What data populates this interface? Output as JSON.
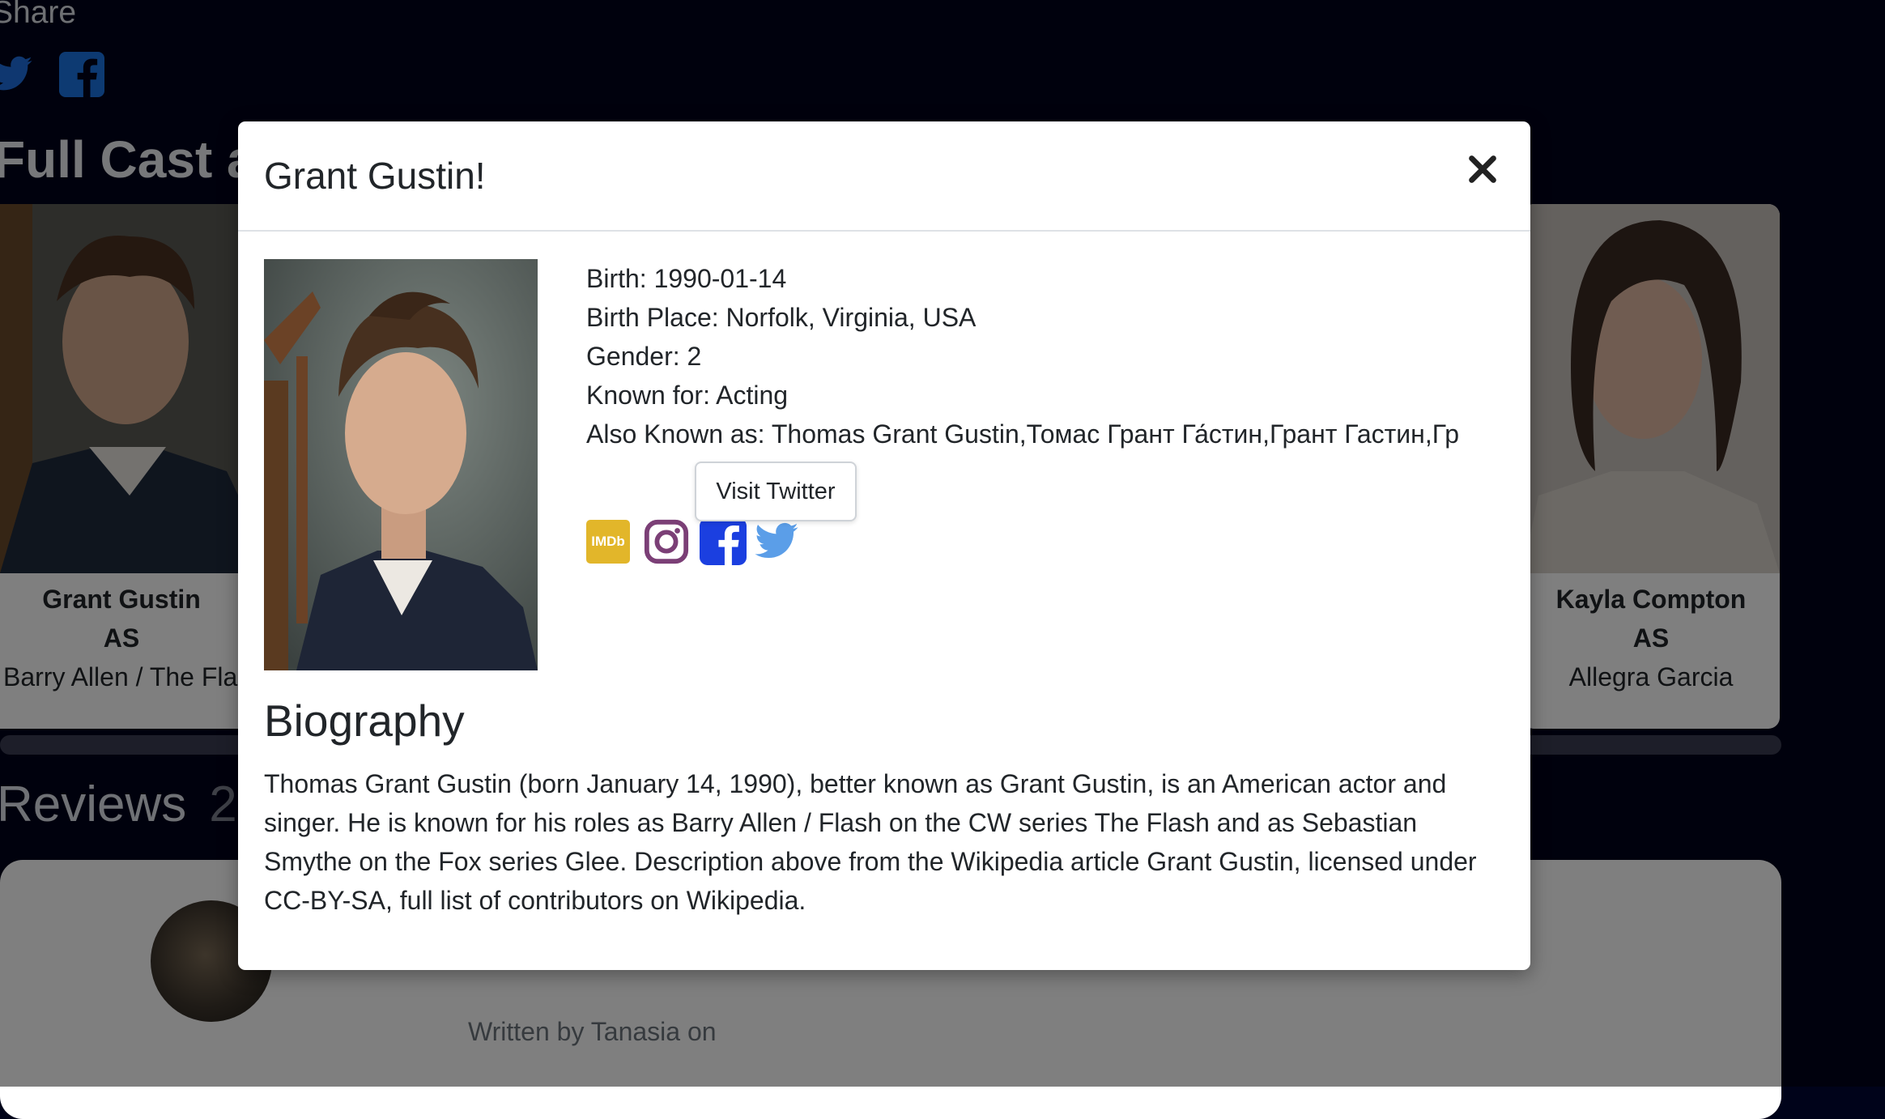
{
  "share": {
    "label": "Share"
  },
  "cast": {
    "heading": "Full Cast a",
    "cards": [
      {
        "name": "Grant Gustin",
        "as": "AS",
        "role": "Barry Allen / The Fla"
      },
      {
        "name": "Kayla Compton",
        "as": "AS",
        "role": "Allegra Garcia"
      }
    ]
  },
  "reviews": {
    "heading": "Reviews",
    "count": "2",
    "first": {
      "written": "Written by Tanasia on"
    }
  },
  "modal": {
    "title": "Grant Gustin!",
    "close_label": "×",
    "birth": "Birth: 1990-01-14",
    "birth_place": "Birth Place: Norfolk, Virginia, USA",
    "gender": "Gender: 2",
    "known_for": "Known for: Acting",
    "also_known_as": "Also Known as: Thomas Grant Gustin,Томас Грант Га́стин,Грант Гастин,Гр",
    "imdb_label": "IMDb",
    "tooltip": "Visit Twitter",
    "bio_heading": "Biography",
    "bio_text": "Thomas Grant Gustin (born January 14, 1990), better known as Grant Gustin, is an American actor and singer. He is known for his roles as Barry Allen / Flash on the CW series The Flash and as Sebastian Smythe on the Fox series Glee. Description above from the Wikipedia article Grant Gustin, licensed under CC-BY-SA, full list of contributors on Wikipedia."
  },
  "colors": {
    "page_bg": "#00031a",
    "imdb": "#e2b62a",
    "instagram": "#7b3f76",
    "facebook": "#1b3fe0",
    "twitter": "#5b9ee8"
  },
  "icons": [
    "twitter-icon",
    "facebook-icon",
    "imdb-icon",
    "instagram-icon",
    "close-icon"
  ]
}
